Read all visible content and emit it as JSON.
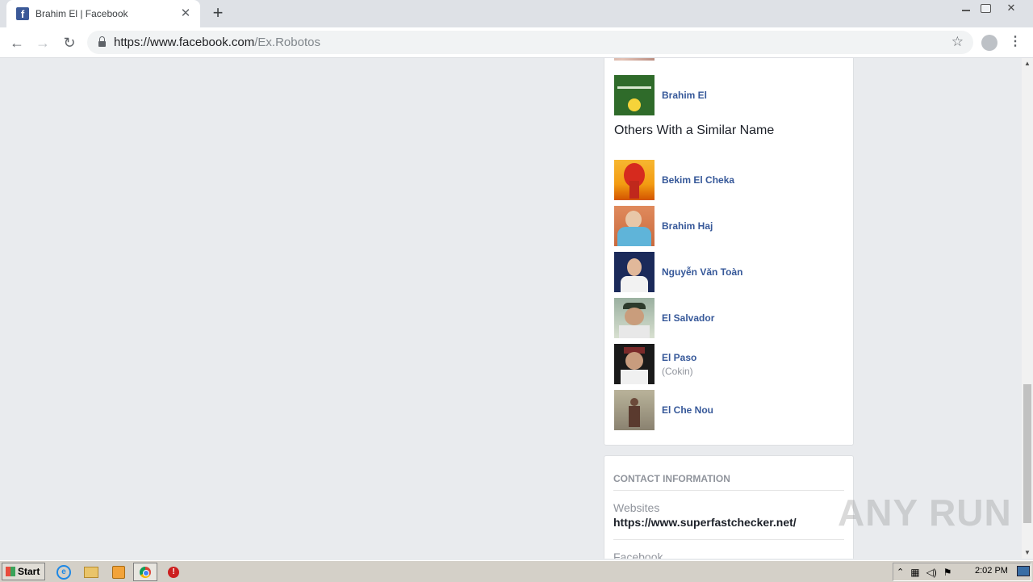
{
  "browser": {
    "tab_title": "Brahim El | Facebook",
    "tab_favicon": "f",
    "url_host": "https://www.facebook.com",
    "url_path": "/Ex.Robotos"
  },
  "people_card": {
    "top_person": "Brahim El",
    "similar_heading": "Others With a Similar Name",
    "people": [
      {
        "name": "Bekim El Cheka",
        "sub": ""
      },
      {
        "name": "Brahim Haj",
        "sub": ""
      },
      {
        "name": "Nguyễn Văn Toàn",
        "sub": ""
      },
      {
        "name": "El Salvador",
        "sub": ""
      },
      {
        "name": "El Paso",
        "sub": "(Cokin)"
      },
      {
        "name": "El Che Nou",
        "sub": ""
      }
    ]
  },
  "contact": {
    "heading": "CONTACT INFORMATION",
    "websites_label": "Websites",
    "website": "https://www.superfastchecker.net/",
    "facebook_label": "Facebook"
  },
  "watermark": "ANY RUN",
  "taskbar": {
    "start_label": "Start",
    "clock": "2:02 PM"
  },
  "colors": {
    "link": "#365899",
    "page_bg": "#e9ebee"
  }
}
